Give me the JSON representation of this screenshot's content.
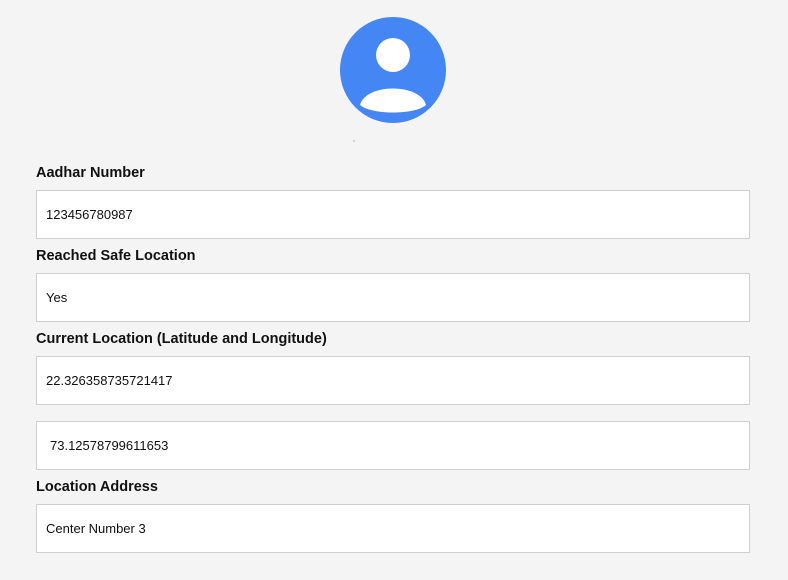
{
  "avatar": {
    "icon": "user-avatar-icon",
    "color": "#4487f4"
  },
  "form": {
    "aadhar": {
      "label": "Aadhar Number",
      "value": "123456780987"
    },
    "reached_safe": {
      "label": "Reached Safe Location",
      "value": "Yes"
    },
    "current_location": {
      "label": "Current Location (Latitude and Longitude)",
      "latitude": "22.326358735721417",
      "longitude": "73.12578799611653"
    },
    "address": {
      "label": "Location Address",
      "value": "Center Number 3"
    }
  }
}
